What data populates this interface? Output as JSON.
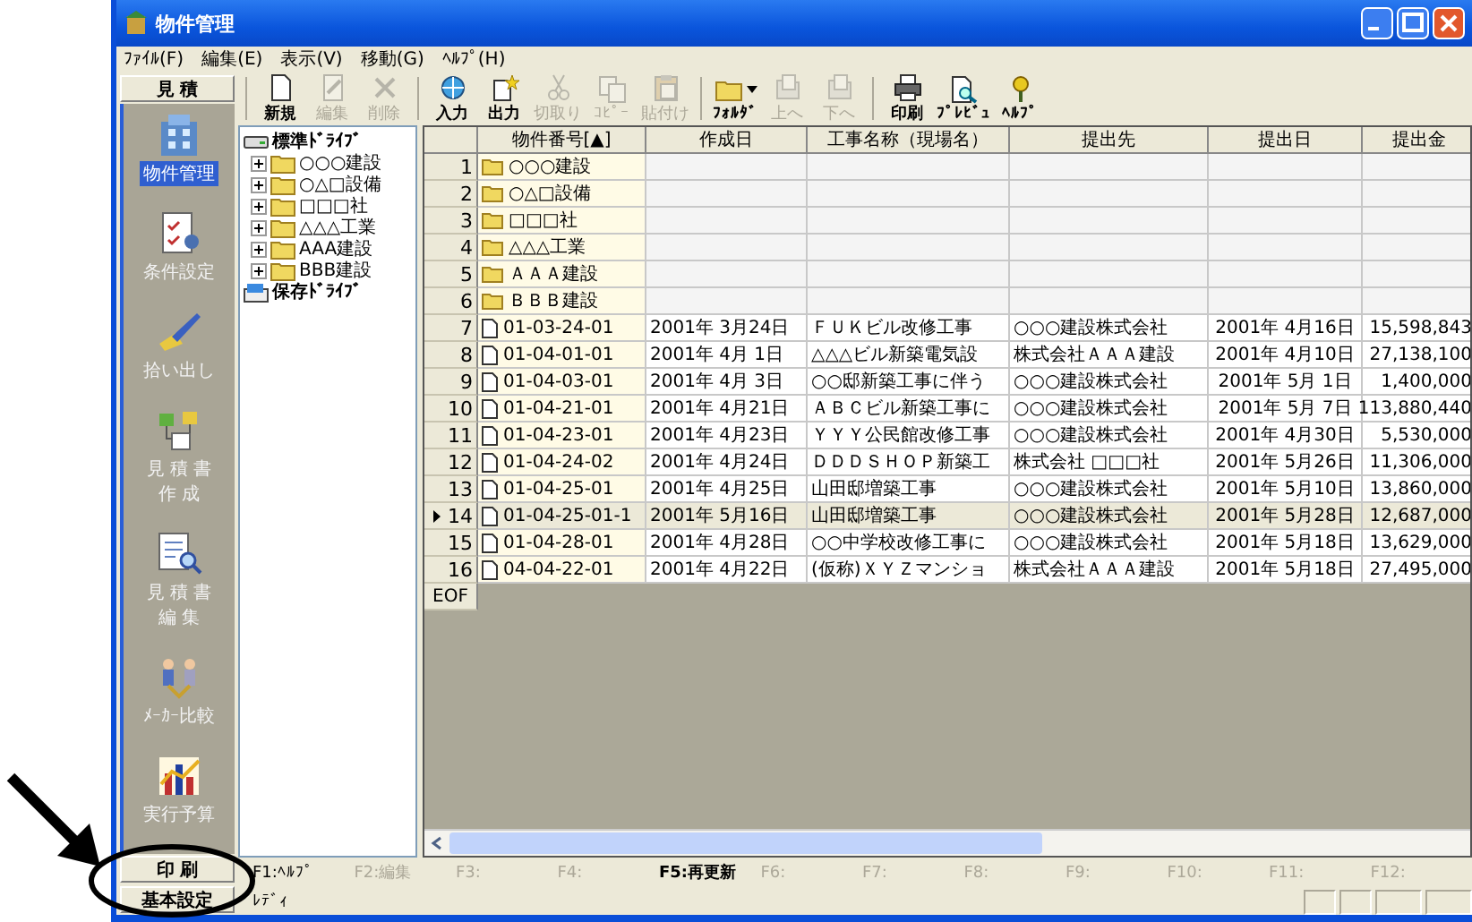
{
  "window": {
    "title": "物件管理"
  },
  "menu": [
    "ﾌｧｲﾙ(F)",
    "編集(E)",
    "表示(V)",
    "移動(G)",
    "ﾍﾙﾌﾟ(H)"
  ],
  "toolbar": [
    {
      "buttons": [
        {
          "label": "新規",
          "disabled": false
        },
        {
          "label": "編集",
          "disabled": true
        },
        {
          "label": "削除",
          "disabled": true
        }
      ]
    },
    {
      "buttons": [
        {
          "label": "入力",
          "disabled": false
        },
        {
          "label": "出力",
          "disabled": false
        },
        {
          "label": "切取り",
          "disabled": true
        },
        {
          "label": "ｺﾋﾟｰ",
          "disabled": true
        },
        {
          "label": "貼付け",
          "disabled": true
        }
      ]
    },
    {
      "buttons": [
        {
          "label": "ﾌｫﾙﾀﾞ",
          "disabled": false,
          "dropdown": true
        },
        {
          "label": "上へ",
          "disabled": true
        },
        {
          "label": "下へ",
          "disabled": true
        }
      ]
    },
    {
      "buttons": [
        {
          "label": "印刷",
          "disabled": false
        },
        {
          "label": "ﾌﾟﾚﾋﾞｭ",
          "disabled": false
        },
        {
          "label": "ﾍﾙﾌﾟ",
          "disabled": false
        }
      ]
    }
  ],
  "sidebar": {
    "header": "見 積",
    "items": [
      {
        "lines": [
          "物件管理"
        ],
        "selected": true
      },
      {
        "lines": [
          "条件設定"
        ],
        "selected": false
      },
      {
        "lines": [
          "拾い出し"
        ],
        "selected": false
      },
      {
        "lines": [
          "見 積 書",
          "作 成"
        ],
        "selected": false
      },
      {
        "lines": [
          "見 積 書",
          "編 集"
        ],
        "selected": false
      },
      {
        "lines": [
          "ﾒｰｶｰ比較"
        ],
        "selected": false
      },
      {
        "lines": [
          "実行予算"
        ],
        "selected": false
      }
    ],
    "footer_buttons": [
      "印 刷",
      "基本設定"
    ]
  },
  "tree": [
    {
      "label": "標準ﾄﾞﾗｲﾌﾞ",
      "kind": "drive",
      "expanded": true,
      "children": [
        {
          "label": "○○○建設",
          "expanded": false
        },
        {
          "label": "○△□設備",
          "expanded": false
        },
        {
          "label": "□□□社",
          "expanded": false
        },
        {
          "label": "△△△工業",
          "expanded": false
        },
        {
          "label": "AAA建設",
          "expanded": false
        },
        {
          "label": "BBB建設",
          "expanded": false
        }
      ]
    },
    {
      "label": "保存ﾄﾞﾗｲﾌﾞ",
      "kind": "save-drive",
      "expanded": false
    }
  ],
  "table": {
    "columns": [
      "物件番号[▲]",
      "作成日",
      "工事名称（現場名）",
      "提出先",
      "提出日",
      "提出金"
    ],
    "rows": [
      {
        "number": "1",
        "kind": "folder",
        "selected": false,
        "cells": [
          "○○○建設"
        ]
      },
      {
        "number": "2",
        "kind": "folder",
        "selected": false,
        "cells": [
          "○△□設備"
        ]
      },
      {
        "number": "3",
        "kind": "folder",
        "selected": false,
        "cells": [
          "□□□社"
        ]
      },
      {
        "number": "4",
        "kind": "folder",
        "selected": false,
        "cells": [
          "△△△工業"
        ]
      },
      {
        "number": "5",
        "kind": "folder",
        "selected": false,
        "cells": [
          "ＡＡＡ建設"
        ]
      },
      {
        "number": "6",
        "kind": "folder",
        "selected": false,
        "cells": [
          "ＢＢＢ建設"
        ]
      },
      {
        "number": "7",
        "kind": "file",
        "selected": false,
        "cells": [
          "01-03-24-01",
          "2001年 3月24日",
          "ＦＵＫビル改修工事",
          "○○○建設株式会社",
          "2001年 4月16日",
          "15,598,843"
        ]
      },
      {
        "number": "8",
        "kind": "file",
        "selected": false,
        "cells": [
          "01-04-01-01",
          "2001年 4月 1日",
          "△△△ビル新築電気設",
          "株式会社ＡＡＡ建設",
          "2001年 4月10日",
          "27,138,100"
        ]
      },
      {
        "number": "9",
        "kind": "file",
        "selected": false,
        "cells": [
          "01-04-03-01",
          "2001年 4月 3日",
          "○○邸新築工事に伴う",
          "○○○建設株式会社",
          "2001年 5月 1日",
          "1,400,000"
        ]
      },
      {
        "number": "10",
        "kind": "file",
        "selected": false,
        "cells": [
          "01-04-21-01",
          "2001年 4月21日",
          "ＡＢＣビル新築工事に",
          "○○○建設株式会社",
          "2001年 5月 7日",
          "113,880,440"
        ]
      },
      {
        "number": "11",
        "kind": "file",
        "selected": false,
        "cells": [
          "01-04-23-01",
          "2001年 4月23日",
          "ＹＹＹ公民館改修工事",
          "○○○建設株式会社",
          "2001年 4月30日",
          "5,530,000"
        ]
      },
      {
        "number": "12",
        "kind": "file",
        "selected": false,
        "cells": [
          "01-04-24-02",
          "2001年 4月24日",
          "ＤＤＤＳＨＯＰ新築工",
          "株式会社 □□□社",
          "2001年 5月26日",
          "11,306,000"
        ]
      },
      {
        "number": "13",
        "kind": "file",
        "selected": false,
        "cells": [
          "01-04-25-01",
          "2001年 4月25日",
          "山田邸増築工事",
          "○○○建設株式会社",
          "2001年 5月10日",
          "13,860,000"
        ]
      },
      {
        "number": "14",
        "kind": "file",
        "selected": true,
        "cells": [
          "01-04-25-01-1",
          "2001年 5月16日",
          "山田邸増築工事",
          "○○○建設株式会社",
          "2001年 5月28日",
          "12,687,000"
        ]
      },
      {
        "number": "15",
        "kind": "file",
        "selected": false,
        "cells": [
          "01-04-28-01",
          "2001年 4月28日",
          "○○中学校改修工事に",
          "○○○建設株式会社",
          "2001年 5月18日",
          "13,629,000"
        ]
      },
      {
        "number": "16",
        "kind": "file",
        "selected": false,
        "cells": [
          "04-04-22-01",
          "2001年 4月22日",
          "(仮称)ＸＹＺマンショ",
          "株式会社ＡＡＡ建設",
          "2001年 5月18日",
          "27,495,000"
        ]
      }
    ],
    "end_marker": "EOF"
  },
  "function_keys": [
    {
      "label": "F1:ﾍﾙﾌﾟ",
      "disabled": false,
      "emphasized": false
    },
    {
      "label": "F2:編集",
      "disabled": true,
      "emphasized": false
    },
    {
      "label": "F3:",
      "disabled": true,
      "emphasized": false
    },
    {
      "label": "F4:",
      "disabled": true,
      "emphasized": false
    },
    {
      "label": "F5:再更新",
      "disabled": false,
      "emphasized": true
    },
    {
      "label": "F6:",
      "disabled": true,
      "emphasized": false
    },
    {
      "label": "F7:",
      "disabled": true,
      "emphasized": false
    },
    {
      "label": "F8:",
      "disabled": true,
      "emphasized": false
    },
    {
      "label": "F9:",
      "disabled": true,
      "emphasized": false
    },
    {
      "label": "F10:",
      "disabled": true,
      "emphasized": false
    },
    {
      "label": "F11:",
      "disabled": true,
      "emphasized": false
    },
    {
      "label": "F12:",
      "disabled": true,
      "emphasized": false
    }
  ],
  "status_bar": {
    "text": "ﾚﾃﾞｨ"
  }
}
